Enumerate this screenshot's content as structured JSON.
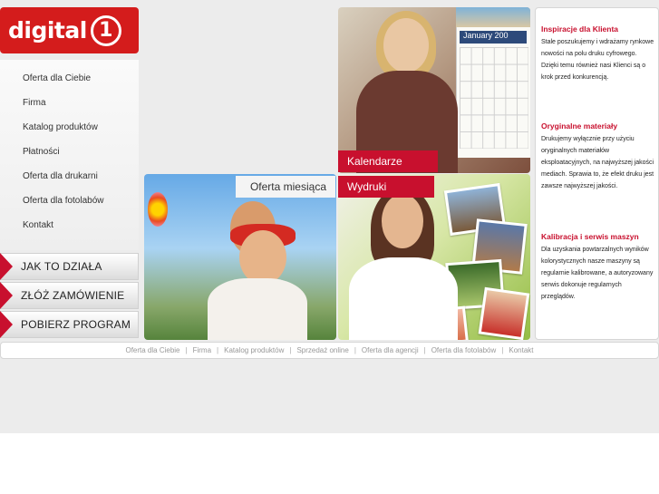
{
  "brand": {
    "logo_text": "digital",
    "logo_number": "1",
    "color": "#d41c1c"
  },
  "menu": [
    "Oferta dla Ciebie",
    "Firma",
    "Katalog produktów",
    "Płatności",
    "Oferta dla drukarni",
    "Oferta dla fotolabów",
    "Kontakt"
  ],
  "actions": [
    "JAK TO DZIAŁA",
    "ZŁÓŻ ZAMÓWIENIE",
    "POBIERZ PROGRAM"
  ],
  "tiles": {
    "kalendarze": "Kalendarze",
    "oferta": "Oferta miesiąca",
    "wydruki": "Wydruki",
    "calendar_month": "January",
    "calendar_year": "200"
  },
  "info": [
    {
      "title": "Inspiracje dla Klienta",
      "text": "Stale poszukujemy i wdrażamy rynkowe nowości na polu druku cyfrowego. Dzięki temu również nasi Klienci są o krok przed konkurencją."
    },
    {
      "title": "Oryginalne materiały",
      "text": "Drukujemy wyłącznie przy użyciu oryginalnych materiałów eksploatacyjnych, na najwyższej jakości mediach. Sprawia to, że efekt druku jest zawsze najwyższej jakości."
    },
    {
      "title": "Kalibracja i serwis maszyn",
      "text": "Dla uzyskania powtarzalnych wyników kolorystycznych nasze maszyny są regularnie kalibrowane, a autoryzowany serwis dokonuje regularnych przeglądów."
    }
  ],
  "footer": [
    "Oferta dla Ciebie",
    "Firma",
    "Katalog produktów",
    "Sprzedaż online",
    "Oferta dla agencji",
    "Oferta dla fotolabów",
    "Kontakt"
  ],
  "footer_separator": "|"
}
